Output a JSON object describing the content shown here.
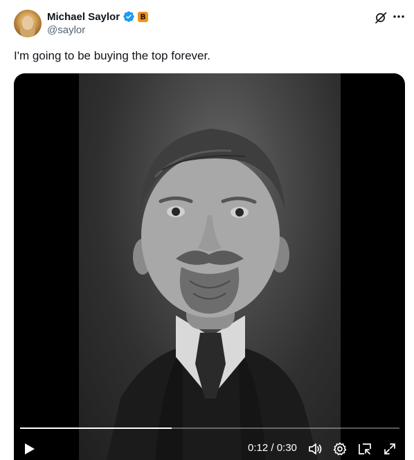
{
  "author": {
    "display_name": "Michael Saylor",
    "handle": "@saylor",
    "verified_icon": "verified-badge-icon",
    "affiliation_badge": "B"
  },
  "tweet": {
    "text": "I'm going to be buying the top forever."
  },
  "video": {
    "current_time": "0:12",
    "duration": "0:30",
    "time_display": "0:12 / 0:30",
    "progress_fraction": 0.4
  },
  "icons": {
    "grok": "grok-icon",
    "more": "more-dots-icon",
    "play": "play-icon",
    "volume": "volume-icon",
    "settings": "gear-icon",
    "pip": "pip-icon",
    "fullscreen": "fullscreen-icon"
  },
  "colors": {
    "text_primary": "#0f1419",
    "text_secondary": "#536471",
    "verified_blue": "#1d9bf0",
    "affiliation_orange": "#f7931a"
  }
}
